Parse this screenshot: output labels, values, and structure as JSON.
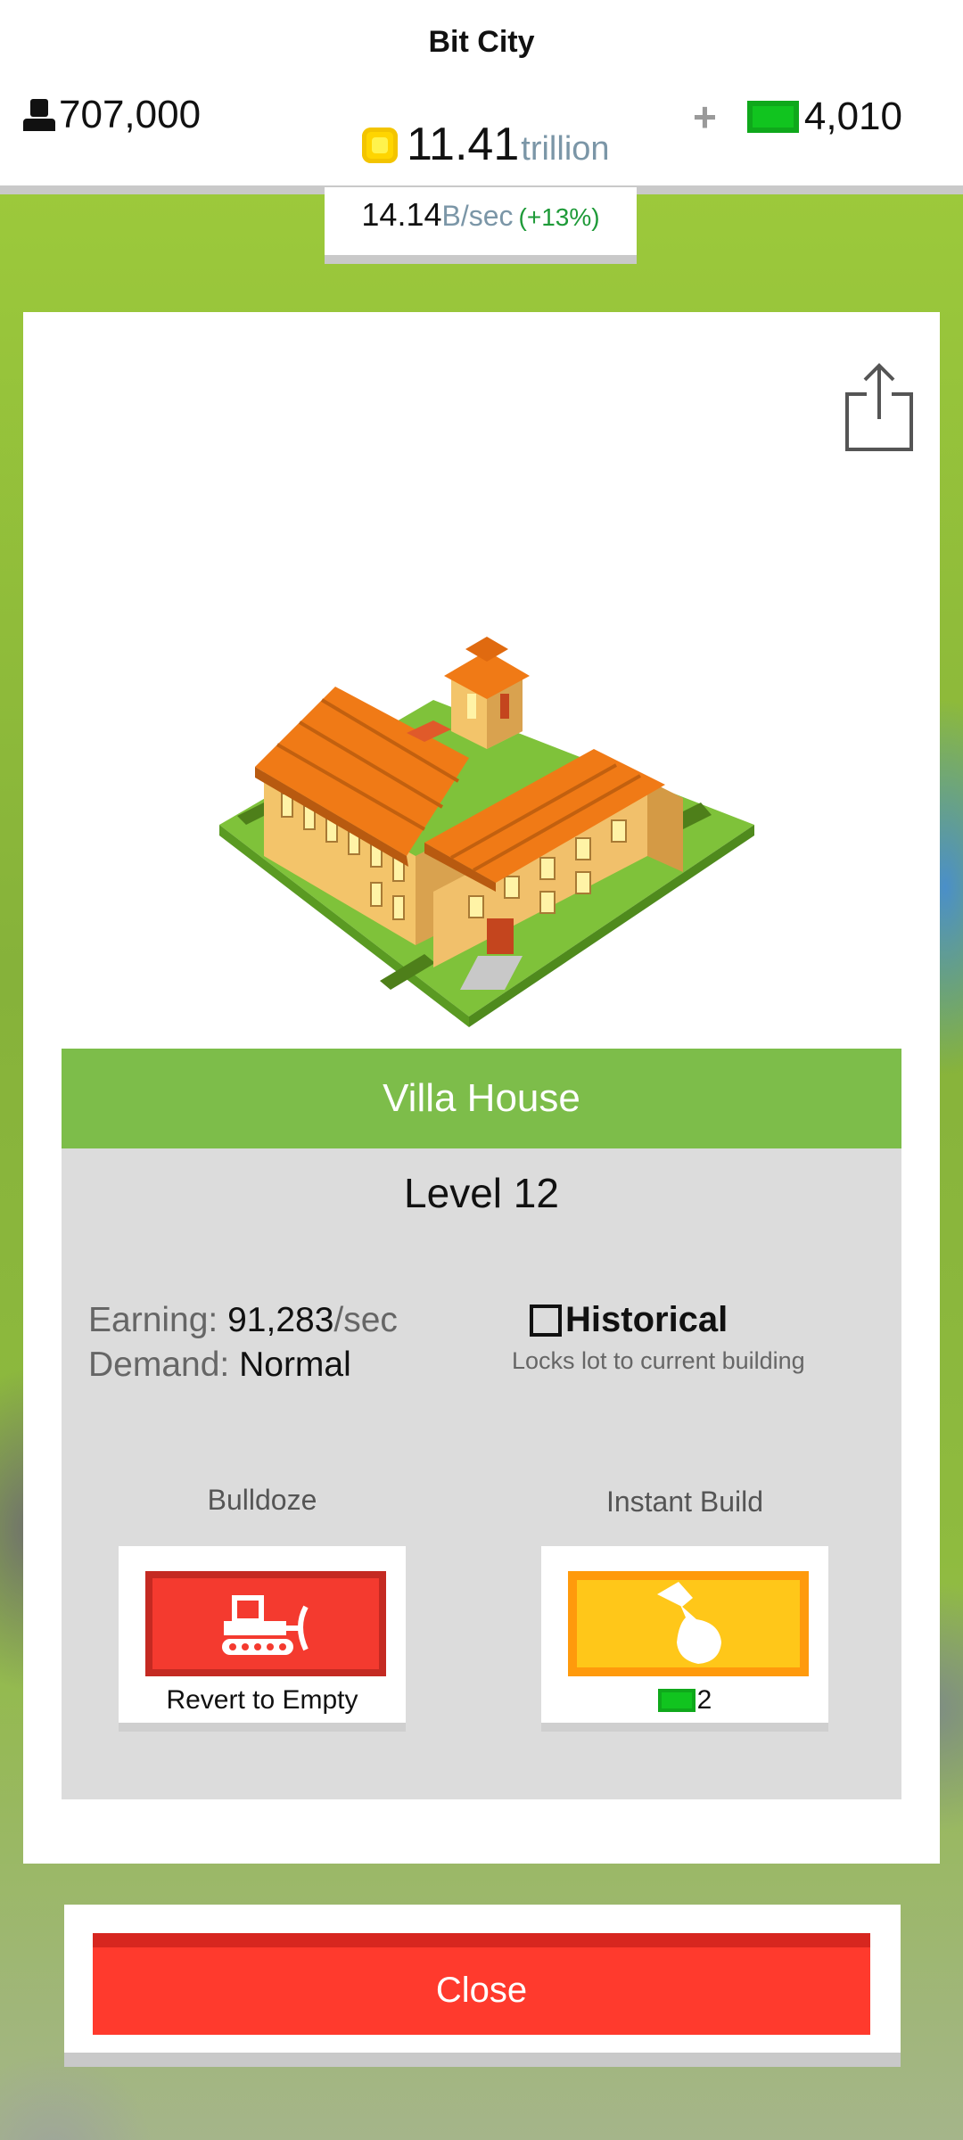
{
  "app": {
    "title": "Bit City"
  },
  "hud": {
    "population": "707,000",
    "coins_amount": "11.41",
    "coins_unit": "trillion",
    "plus": "+",
    "cash": "4,010",
    "rate_value": "14.14",
    "rate_unit": "B/sec",
    "rate_percent": "(+13%)"
  },
  "building": {
    "name": "Villa House",
    "level": "Level 12",
    "earning_label": "Earning:",
    "earning_value": "91,283",
    "earning_unit": "/sec",
    "demand_label": "Demand:",
    "demand_value": "Normal",
    "historical_label": "Historical",
    "historical_checked": false,
    "historical_sub": "Locks lot to current building"
  },
  "actions": {
    "bulldoze_title": "Bulldoze",
    "bulldoze_caption": "Revert to Empty",
    "instant_title": "Instant Build",
    "instant_cost": "2"
  },
  "footer": {
    "close_label": "Close"
  },
  "icons": [
    "person-icon",
    "coin-icon",
    "cash-icon",
    "share-icon",
    "bulldozer-icon",
    "hammer-icon"
  ],
  "colors": {
    "green_bar": "#7dbd4a",
    "red_button": "#f43a2f",
    "yellow_button": "#ffc719",
    "cash_green": "#11c41f"
  }
}
